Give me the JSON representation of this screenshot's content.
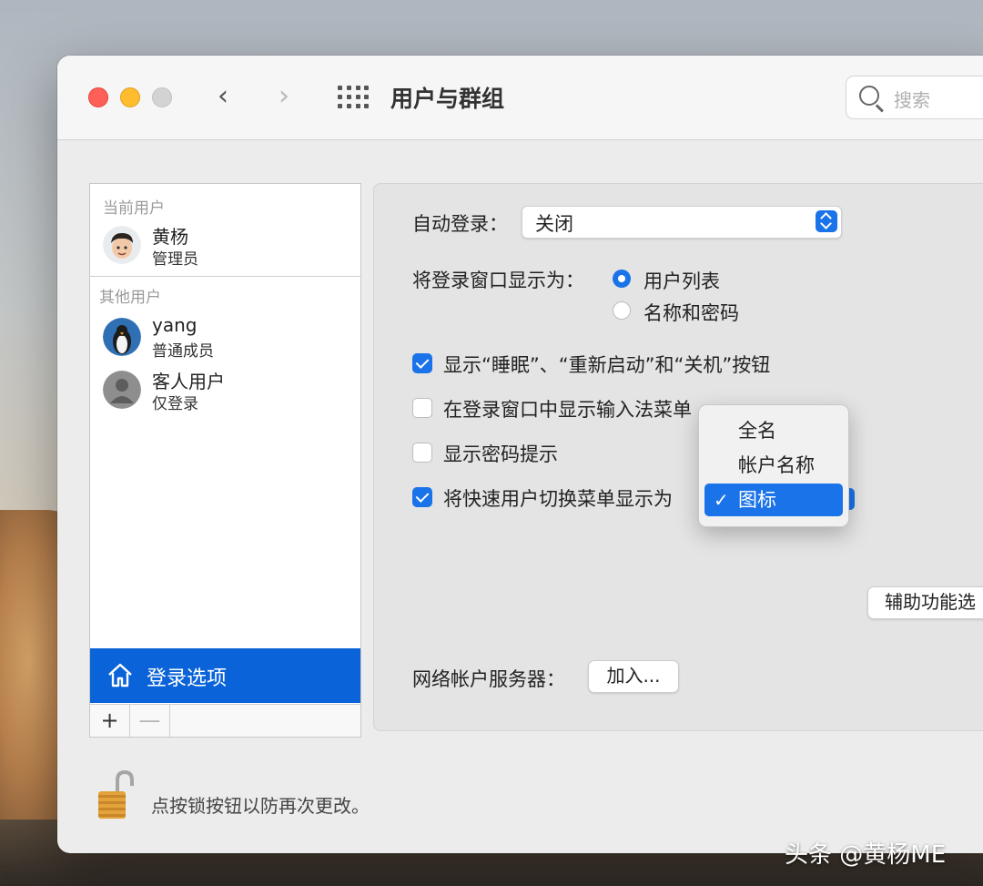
{
  "window": {
    "title": "用户与群组",
    "search_placeholder": "搜索"
  },
  "sidebar": {
    "current_section": "当前用户",
    "other_section": "其他用户",
    "users": [
      {
        "name": "黄杨",
        "role": "管理员"
      },
      {
        "name": "yang",
        "role": "普通成员"
      },
      {
        "name": "客人用户",
        "role": "仅登录"
      }
    ],
    "login_options": "登录选项",
    "add_label": "+",
    "remove_label": "—"
  },
  "panel": {
    "auto_login_label": "自动登录：",
    "auto_login_value": "关闭",
    "display_as_label": "将登录窗口显示为：",
    "radio_user_list": "用户列表",
    "radio_name_password": "名称和密码",
    "cb_show_buttons": "显示“睡眠”、“重新启动”和“关机”按钮",
    "cb_input_menu": "在登录窗口中显示输入法菜单",
    "cb_password_hints": "显示密码提示",
    "cb_fast_switch": "将快速用户切换菜单显示为",
    "accessibility_button": "辅助功能选",
    "network_server_label": "网络帐户服务器：",
    "join_button": "加入..."
  },
  "dropdown": {
    "items": [
      "全名",
      "帐户名称",
      "图标"
    ],
    "selected": "图标",
    "check": "✓"
  },
  "footer": {
    "lock_text": "点按锁按钮以防再次更改。"
  },
  "watermark": "头条 @黄杨ME",
  "colors": {
    "accent": "#1a73e8",
    "selection": "#0a63d8"
  }
}
